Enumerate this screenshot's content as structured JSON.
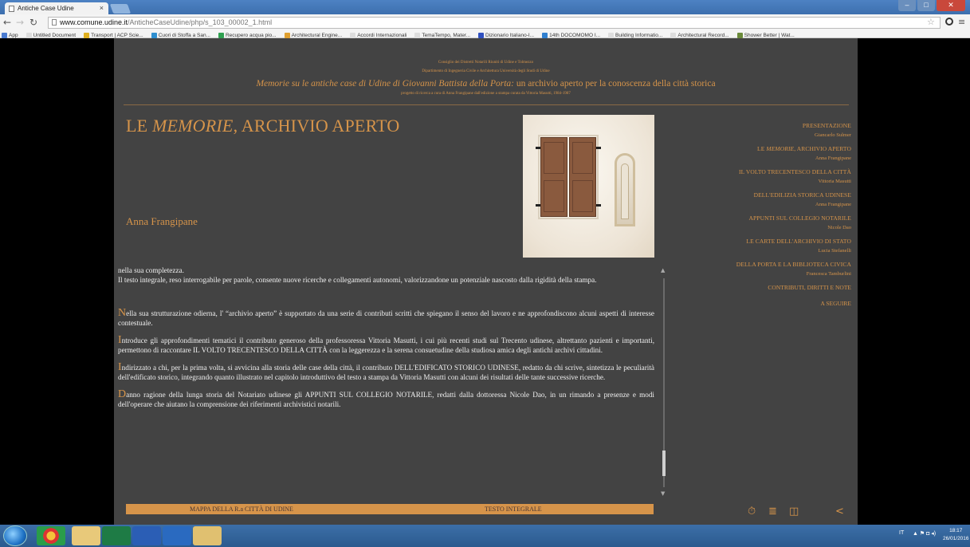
{
  "browser": {
    "tab_title": "Antiche Case Udine",
    "tab_close": "×",
    "url_host": "www.comune.udine.it",
    "url_path": "/AnticheCaseUdine/php/s_103_00002_1.html",
    "bookmarks": [
      {
        "label": "App",
        "color": "#4a7bd0"
      },
      {
        "label": "Untitled Document",
        "color": "#dddddd"
      },
      {
        "label": "Transport | ACP Scie...",
        "color": "#e0b020"
      },
      {
        "label": "Cuori di Stoffa a San...",
        "color": "#2f8fd0"
      },
      {
        "label": "Recupero acqua pio...",
        "color": "#2fa050"
      },
      {
        "label": "Architectural Engine...",
        "color": "#e0a030"
      },
      {
        "label": "Accordi Internazionali",
        "color": "#dddddd"
      },
      {
        "label": "TemaTempo, Mater...",
        "color": "#dddddd"
      },
      {
        "label": "Dizionario Italiano-I...",
        "color": "#3050c0"
      },
      {
        "label": "14th DOCOMOMO I...",
        "color": "#3080d0"
      },
      {
        "label": "Building Informatio...",
        "color": "#dddddd"
      },
      {
        "label": "Architectural Record...",
        "color": "#dddddd"
      },
      {
        "label": "Shower Better | Wat...",
        "color": "#6a8a3a"
      }
    ]
  },
  "header": {
    "line1": "Consiglio dei Distretti Notarili Riuniti di Udine e Tolmezzo",
    "line2": "Dipartimento di Ingegneria Civile e Architettura Università degli Studi di Udine",
    "line3_italic": "Memorie su le antiche case di Udine di Giovanni Battista della Porta:",
    "line3_rest": " un archivio aperto per la conoscenza della città storica",
    "line4": "progetto di ricerca a cura di Anna Frangipane dall'edizione a stampa curata da Vittoria Masutti, 1984-1987"
  },
  "article": {
    "title_pre": "LE ",
    "title_em": "MEMORIE",
    "title_post": ", ARCHIVIO APERTO",
    "author": "Anna Frangipane",
    "intro_1": "nella sua completezza.",
    "intro_2": "Il testo integrale, reso interrogabile per parole, consente nuove ricerche e collegamenti autonomi, valorizzandone un potenziale nascosto dalla rigidità della stampa.",
    "paragraphs": [
      {
        "initial": "N",
        "rest": "ella sua strutturazione odierna, l' “archivio aperto” è supportato da una serie di contributi scritti che spiegano il senso del lavoro e ne approfondiscono alcuni aspetti di interesse contestuale."
      },
      {
        "initial": "I",
        "rest": "ntroduce gli approfondimenti tematici il contributo generoso della professoressa Vittoria Masutti, i cui più recenti studi sul Trecento udinese, altrettanto pazienti e importanti, permettono di raccontare IL VOLTO TRECENTESCO DELLA CITTÀ con la leggerezza e la serena consuetudine della studiosa amica degli antichi archivi cittadini."
      },
      {
        "initial": "I",
        "rest": "ndirizzato a chi, per la prima volta, si avvicina alla storia delle case della città, il contributo DELL'EDIFICATO STORICO UDINESE, redatto da chi scrive, sintetizza le peculiarità dell'edificato storico, integrando quanto illustrato nel capitolo introduttivo del testo a stampa da Vittoria Masutti con alcuni dei risultati delle tante successive ricerche."
      },
      {
        "initial": "D",
        "rest": "anno ragione della lunga storia del Notariato udinese gli APPUNTI SUL COLLEGIO NOTARILE, redatti dalla dottoressa Nicole Dao, in un rimando a presenze e modi dell'operare che aiutano la comprensione dei riferimenti archivistici notarili."
      }
    ]
  },
  "sidebar": {
    "items": [
      {
        "title_pre": "PRESENTAZIONE",
        "title_em": "",
        "title_post": "",
        "author": "Giancarlo Sulmer"
      },
      {
        "title_pre": "LE ",
        "title_em": "MEMORIE",
        "title_post": ", ARCHIVIO APERTO",
        "author": "Anna Frangipane"
      },
      {
        "title_pre": "IL VOLTO TRECENTESCO DELLA CITTÀ",
        "title_em": "",
        "title_post": "",
        "author": "Vittoria Masutti"
      },
      {
        "title_pre": "DELL'EDILIZIA STORICA UDINESE",
        "title_em": "",
        "title_post": "",
        "author": "Anna Frangipane"
      },
      {
        "title_pre": "APPUNTI SUL COLLEGIO NOTARILE",
        "title_em": "",
        "title_post": "",
        "author": "Nicole Dao"
      },
      {
        "title_pre": "LE CARTE DELL'ARCHIVIO DI STATO",
        "title_em": "",
        "title_post": "",
        "author": "Lucia Stefanelli"
      },
      {
        "title_pre": "DELLA PORTA E LA BIBLIOTECA CIVICA",
        "title_em": "",
        "title_post": "",
        "author": "Francesca Tamburlini"
      }
    ],
    "contributi": "CONTRIBUTI, DIRITTI E NOTE",
    "a_seguire": "A SEGUIRE"
  },
  "bottom": {
    "mappa": "MAPPA DELLA R.a CITTÀ DI UDINE",
    "testo": "TESTO INTEGRALE"
  },
  "tools": {
    "clock_icon": "⏱",
    "list_icon": "≣",
    "columns_icon": "◫",
    "back_icon": "<"
  },
  "taskbar": {
    "time": "18:17",
    "date": "26/01/2016",
    "lang": "IT"
  },
  "colors": {
    "accent": "#d6944a",
    "page_bg": "#434343",
    "text": "#f0f0f0"
  }
}
